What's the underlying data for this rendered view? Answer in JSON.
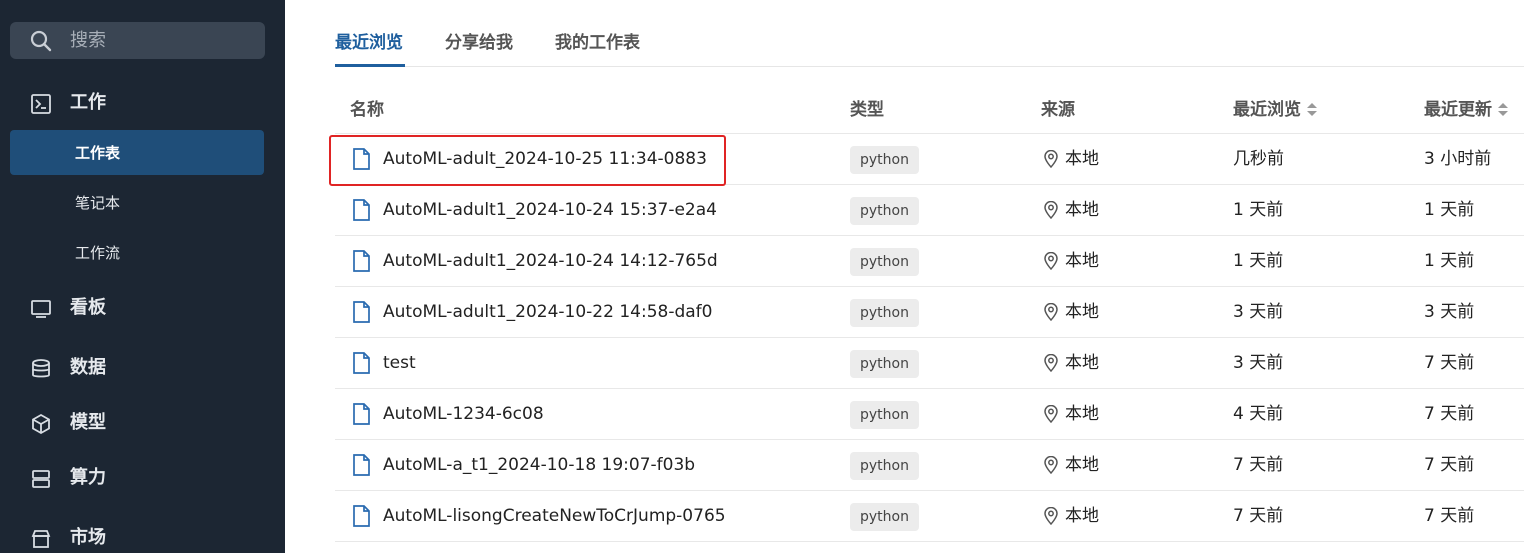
{
  "sidebar": {
    "search_placeholder": "搜索",
    "work_label": "工作",
    "sub_items": [
      "工作表",
      "笔记本",
      "工作流"
    ],
    "board_label": "看板",
    "data_label": "数据",
    "model_label": "模型",
    "compute_label": "算力",
    "market_label": "市场"
  },
  "tabs": [
    "最近浏览",
    "分享给我",
    "我的工作表"
  ],
  "active_tab": 0,
  "columns": {
    "name": "名称",
    "type": "类型",
    "source": "来源",
    "viewed": "最近浏览",
    "updated": "最近更新"
  },
  "rows": [
    {
      "name": "AutoML-adult_2024-10-25 11:34-0883",
      "type": "python",
      "source": "本地",
      "viewed": "几秒前",
      "updated": "3 小时前"
    },
    {
      "name": "AutoML-adult1_2024-10-24 15:37-e2a4",
      "type": "python",
      "source": "本地",
      "viewed": "1 天前",
      "updated": "1 天前"
    },
    {
      "name": "AutoML-adult1_2024-10-24 14:12-765d",
      "type": "python",
      "source": "本地",
      "viewed": "1 天前",
      "updated": "1 天前"
    },
    {
      "name": "AutoML-adult1_2024-10-22 14:58-daf0",
      "type": "python",
      "source": "本地",
      "viewed": "3 天前",
      "updated": "3 天前"
    },
    {
      "name": "test",
      "type": "python",
      "source": "本地",
      "viewed": "3 天前",
      "updated": "7 天前"
    },
    {
      "name": "AutoML-1234-6c08",
      "type": "python",
      "source": "本地",
      "viewed": "4 天前",
      "updated": "7 天前"
    },
    {
      "name": "AutoML-a_t1_2024-10-18 19:07-f03b",
      "type": "python",
      "source": "本地",
      "viewed": "7 天前",
      "updated": "7 天前"
    },
    {
      "name": "AutoML-lisongCreateNewToCrJump-0765",
      "type": "python",
      "source": "本地",
      "viewed": "7 天前",
      "updated": "7 天前"
    }
  ],
  "highlighted_row": 0,
  "colors": {
    "sidebar_bg": "#1c2633",
    "active_item_bg": "#1f4e79",
    "accent": "#1f5f9e",
    "highlight_border": "#e02424"
  }
}
